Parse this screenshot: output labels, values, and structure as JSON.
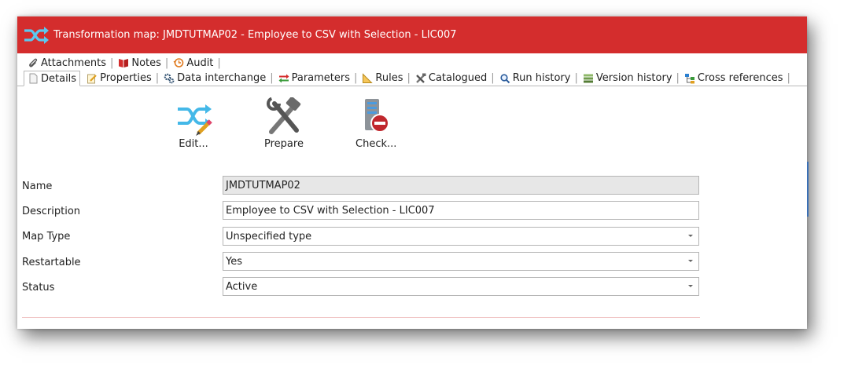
{
  "window": {
    "title": "Transformation map: JMDTUTMAP02 - Employee to CSV with Selection - LIC007",
    "title_icon": "shuffle-icon",
    "accent_color": "#d42d2d"
  },
  "tabs_row1": [
    {
      "label": "Attachments",
      "icon": "paperclip-icon"
    },
    {
      "label": "Notes",
      "icon": "book-icon"
    },
    {
      "label": "Audit",
      "icon": "history-icon"
    }
  ],
  "tabs_row2": [
    {
      "label": "Details",
      "icon": "document-icon",
      "active": true
    },
    {
      "label": "Properties",
      "icon": "pencil-note-icon"
    },
    {
      "label": "Data interchange",
      "icon": "gears-icon"
    },
    {
      "label": "Parameters",
      "icon": "arrows-icon"
    },
    {
      "label": "Rules",
      "icon": "ruler-icon"
    },
    {
      "label": "Catalogued",
      "icon": "tools-icon"
    },
    {
      "label": "Run history",
      "icon": "magnifier-icon"
    },
    {
      "label": "Version history",
      "icon": "layers-icon"
    },
    {
      "label": "Cross references",
      "icon": "hierarchy-icon"
    }
  ],
  "toolbar": {
    "edit_label": "Edit...",
    "prepare_label": "Prepare",
    "check_label": "Check..."
  },
  "form": {
    "name_label": "Name",
    "name_value": "JMDTUTMAP02",
    "description_label": "Description",
    "description_value": "Employee to CSV with Selection - LIC007",
    "maptype_label": "Map Type",
    "maptype_value": "Unspecified type",
    "restartable_label": "Restartable",
    "restartable_value": "Yes",
    "status_label": "Status",
    "status_value": "Active"
  }
}
